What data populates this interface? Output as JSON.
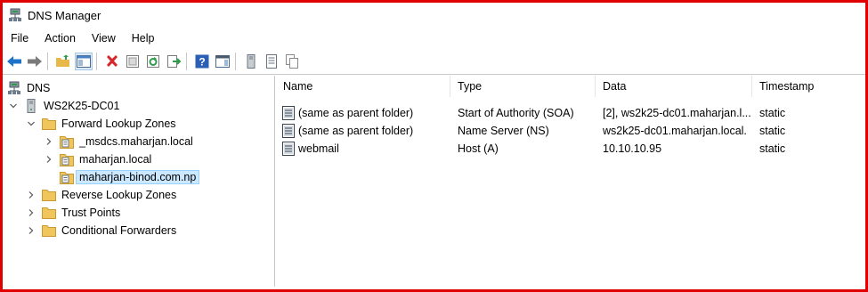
{
  "window": {
    "title": "DNS Manager"
  },
  "menu": [
    "File",
    "Action",
    "View",
    "Help"
  ],
  "toolbar": {
    "icons": [
      "back-icon",
      "forward-icon",
      "up-folder-icon",
      "show-hide-tree-icon",
      "delete-icon",
      "properties-icon",
      "refresh-icon",
      "export-list-icon",
      "help-icon",
      "show-hide-action-pane-icon",
      "server-icon",
      "records-list-icon",
      "copy-icon"
    ]
  },
  "tree": {
    "root": "DNS",
    "server": "WS2K25-DC01",
    "forward_zones": "Forward Lookup Zones",
    "zones": [
      "_msdcs.maharjan.local",
      "maharjan.local",
      "maharjan-binod.com.np"
    ],
    "reverse_zones": "Reverse Lookup Zones",
    "trust_points": "Trust Points",
    "conditional_forwarders": "Conditional Forwarders"
  },
  "records": {
    "columns": [
      "Name",
      "Type",
      "Data",
      "Timestamp"
    ],
    "rows": [
      {
        "name": "(same as parent folder)",
        "type": "Start of Authority (SOA)",
        "data": "[2], ws2k25-dc01.maharjan.l...",
        "timestamp": "static"
      },
      {
        "name": "(same as parent folder)",
        "type": "Name Server (NS)",
        "data": "ws2k25-dc01.maharjan.local.",
        "timestamp": "static"
      },
      {
        "name": "webmail",
        "type": "Host (A)",
        "data": "10.10.10.95",
        "timestamp": "static"
      }
    ]
  },
  "colors": {
    "frame": "#e00000",
    "selection": "#cce8ff",
    "folder": "#f0c55b"
  }
}
